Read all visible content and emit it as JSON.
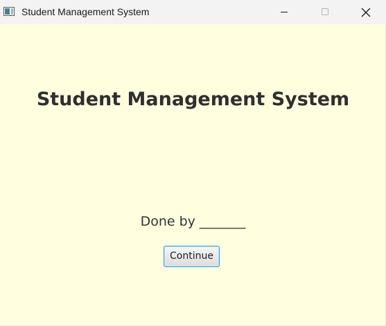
{
  "window": {
    "title": "Student Management System",
    "background": "#ffffe0",
    "controls": {
      "minimize_icon": "minimize-icon",
      "maximize_icon": "maximize-icon",
      "close_icon": "close-icon"
    }
  },
  "main": {
    "heading": "Student Management System",
    "credits": "Done by _______",
    "continue_label": "Continue"
  },
  "colors": {
    "button_focus_border": "#2f9fd6"
  }
}
